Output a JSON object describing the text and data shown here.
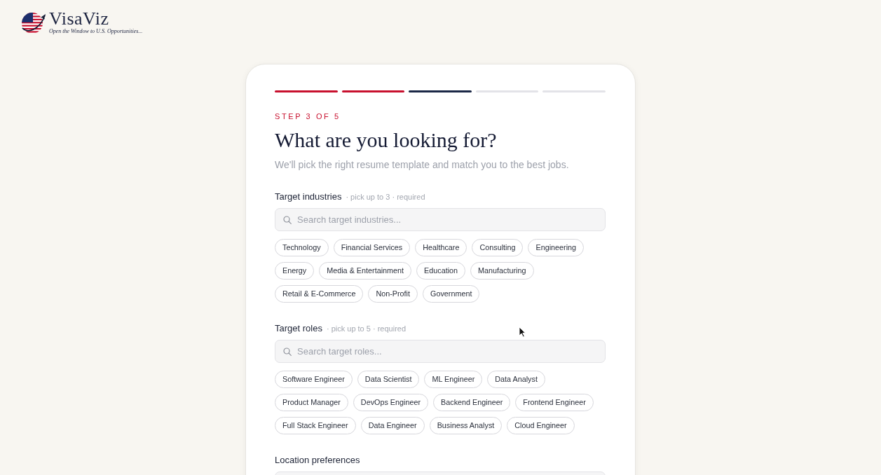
{
  "logo": {
    "name": "VisaViz",
    "tagline": "Open the Window to U.S. Opportunities..."
  },
  "progress": [
    {
      "completed": true,
      "current": false
    },
    {
      "completed": true,
      "current": false
    },
    {
      "completed": false,
      "current": true
    },
    {
      "completed": false,
      "current": false
    },
    {
      "completed": false,
      "current": false
    }
  ],
  "step_label": "STEP 3 OF 5",
  "title": "What are you looking for?",
  "subtitle": "We'll pick the right resume template and match you to the best jobs.",
  "sections": [
    {
      "label": "Target industries",
      "hint": "· pick up to 3 · required",
      "search": {
        "placeholder": "Search target industries..."
      },
      "chips": [
        {
          "label": "Technology",
          "selected": false
        },
        {
          "label": "Financial Services",
          "selected": false
        },
        {
          "label": "Healthcare",
          "selected": false
        },
        {
          "label": "Consulting",
          "selected": false
        },
        {
          "label": "Engineering",
          "selected": false
        },
        {
          "label": "Energy",
          "selected": false
        },
        {
          "label": "Media & Entertainment",
          "selected": false
        },
        {
          "label": "Education",
          "selected": false
        },
        {
          "label": "Manufacturing",
          "selected": false
        },
        {
          "label": "Retail & E-Commerce",
          "selected": false
        },
        {
          "label": "Non-Profit",
          "selected": false
        },
        {
          "label": "Government",
          "selected": false
        }
      ]
    },
    {
      "label": "Target roles",
      "hint": "· pick up to 5 · required",
      "search": {
        "placeholder": "Search target roles..."
      },
      "chips": [
        {
          "label": "Software Engineer",
          "selected": false
        },
        {
          "label": "Data Scientist",
          "selected": false
        },
        {
          "label": "ML Engineer",
          "selected": false
        },
        {
          "label": "Data Analyst",
          "selected": false
        },
        {
          "label": "Product Manager",
          "selected": false
        },
        {
          "label": "DevOps Engineer",
          "selected": false
        },
        {
          "label": "Backend Engineer",
          "selected": false
        },
        {
          "label": "Frontend Engineer",
          "selected": false
        },
        {
          "label": "Full Stack Engineer",
          "selected": false
        },
        {
          "label": "Data Engineer",
          "selected": false
        },
        {
          "label": "Business Analyst",
          "selected": false
        },
        {
          "label": "Cloud Engineer",
          "selected": false
        }
      ]
    },
    {
      "label": "Location preferences"
    }
  ]
}
